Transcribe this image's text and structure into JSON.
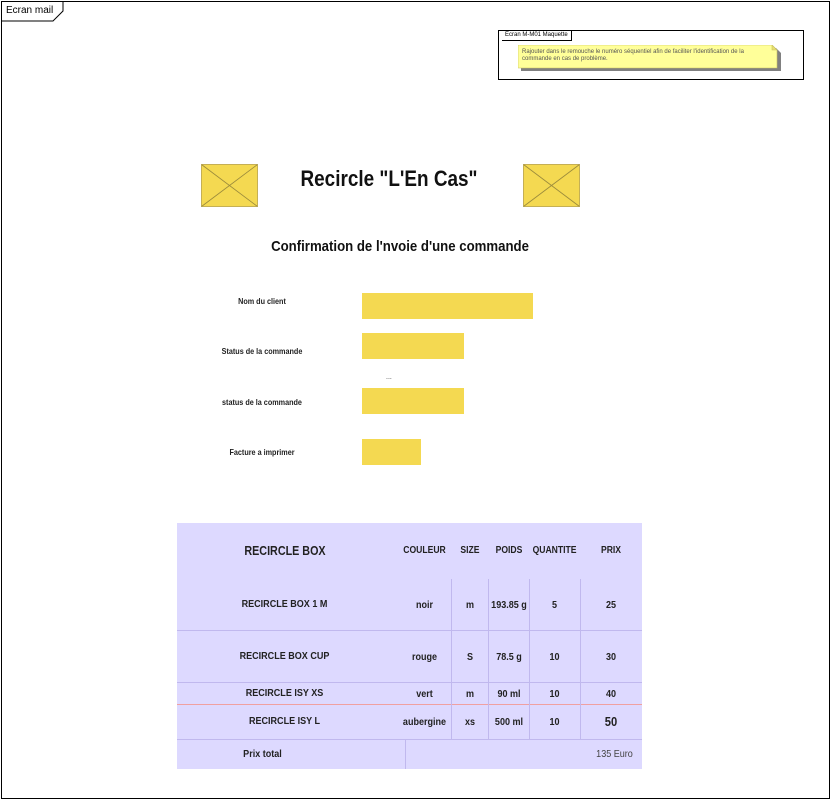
{
  "frame": {
    "title": "Ecran mail"
  },
  "note": {
    "title": "Ecran M-M01 Maquette",
    "text": "Rajouter dans le remouche le numéro séquentiel afin de faciliter l'identification de la commande en cas de problème."
  },
  "icons": {
    "left": "image-placeholder-icon",
    "right": "image-placeholder-icon"
  },
  "app_title": "Recircle \"L'En Cas\"",
  "subtitle": "Confirmation de l'nvoie d'une commande",
  "form": {
    "fields": [
      {
        "label": "Nom du client"
      },
      {
        "label": "Status de la commande"
      },
      {
        "label": "status de la commande"
      },
      {
        "label": "Facture a imprimer"
      }
    ],
    "separator": "..."
  },
  "table": {
    "headers": [
      "RECIRCLE BOX",
      "COULEUR",
      "SIZE",
      "POIDS",
      "QUANTITE",
      "PRIX"
    ],
    "rows": [
      [
        "RECIRCLE BOX 1 M",
        "noir",
        "m",
        "193.85 g",
        "5",
        "25"
      ],
      [
        "RECIRCLE BOX CUP",
        "rouge",
        "S",
        "78.5 g",
        "10",
        "30"
      ],
      [
        "RECIRCLE ISY XS",
        "vert",
        "m",
        "90 ml",
        "10",
        "40"
      ],
      [
        "RECIRCLE ISY L",
        "aubergine",
        "xs",
        "500 ml",
        "10",
        "50"
      ]
    ],
    "total_label": "Prix total",
    "total_value": "135 Euro"
  },
  "colors": {
    "field_fill": "#f4d951",
    "table_bg": "#ddd9ff",
    "note_fill": "#ffff99"
  }
}
